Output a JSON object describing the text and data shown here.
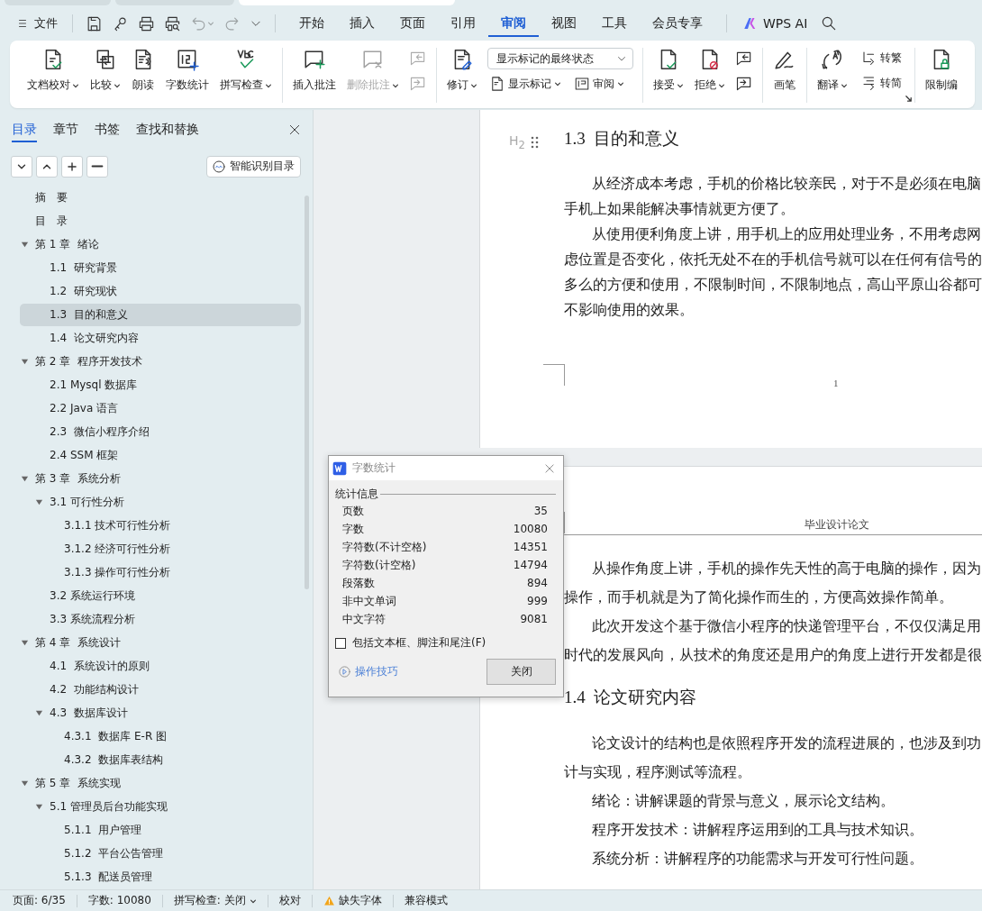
{
  "document_tabs": [
    {
      "selected": false
    },
    {
      "selected": false
    },
    {
      "selected": true
    }
  ],
  "file_menu": {
    "label": "文件"
  },
  "quick_access": [
    {
      "disabled": false
    },
    {
      "disabled": false
    },
    {
      "disabled": false
    },
    {
      "disabled": false
    },
    {
      "disabled": true
    },
    {
      "disabled": true
    },
    {
      "disabled": false
    }
  ],
  "menu_tabs": [
    {
      "label": "开始",
      "selected": false
    },
    {
      "label": "插入",
      "selected": false
    },
    {
      "label": "页面",
      "selected": false
    },
    {
      "label": "引用",
      "selected": false
    },
    {
      "label": "审阅",
      "selected": true
    },
    {
      "label": "视图",
      "selected": false
    },
    {
      "label": "工具",
      "selected": false
    },
    {
      "label": "会员专享",
      "selected": false
    }
  ],
  "ai_button": {
    "label": "WPS AI"
  },
  "ribbon": {
    "groups": [
      {
        "items": [
          {
            "kind": "large",
            "label": "文档校对",
            "caret": true,
            "disabled": false
          },
          {
            "kind": "large",
            "label": "比较",
            "caret": true,
            "disabled": false
          },
          {
            "kind": "large",
            "label": "朗读",
            "caret": false,
            "disabled": false
          },
          {
            "kind": "large",
            "label": "字数统计",
            "caret": false,
            "disabled": false
          },
          {
            "kind": "large",
            "label": "拼写检查",
            "caret": true,
            "disabled": false
          }
        ]
      },
      {
        "items": [
          {
            "kind": "large",
            "label": "插入批注",
            "caret": false,
            "disabled": false
          },
          {
            "kind": "large",
            "label": "删除批注",
            "caret": true,
            "disabled": true
          },
          {
            "kind": "icons",
            "disabled": true
          }
        ]
      },
      {
        "items": [
          {
            "kind": "large",
            "label": "修订",
            "caret": true,
            "disabled": false
          },
          {
            "kind": "review",
            "select": "显示标记的最终状态",
            "buttons": [
              {
                "label": "显示标记",
                "caret": true
              },
              {
                "label": "审阅",
                "caret": true
              }
            ]
          }
        ]
      },
      {
        "items": [
          {
            "kind": "large",
            "label": "接受",
            "caret": true,
            "disabled": false
          },
          {
            "kind": "large",
            "label": "拒绝",
            "caret": true,
            "disabled": false
          },
          {
            "kind": "icons",
            "disabled": false
          }
        ]
      },
      {
        "items": [
          {
            "kind": "large",
            "label": "画笔",
            "caret": false,
            "disabled": false
          }
        ]
      },
      {
        "items": [
          {
            "kind": "large",
            "label": "翻译",
            "caret": true,
            "disabled": false
          },
          {
            "kind": "convert",
            "buttons": [
              {
                "label": "转繁"
              },
              {
                "label": "转简"
              }
            ]
          }
        ],
        "launcher": true
      },
      {
        "items": [
          {
            "kind": "large",
            "label": "限制编",
            "caret": false,
            "disabled": false
          }
        ]
      }
    ]
  },
  "nav": {
    "tabs": [
      {
        "label": "目录",
        "selected": true
      },
      {
        "label": "章节",
        "selected": false
      },
      {
        "label": "书签",
        "selected": false
      },
      {
        "label": "查找和替换",
        "selected": false
      }
    ],
    "smart_button": {
      "label": "智能识别目录"
    },
    "toc": [
      {
        "label": "摘　要",
        "selected": false
      },
      {
        "label": "目　录",
        "selected": false
      },
      {
        "label": "第 1 章  绪论",
        "selected": false,
        "expanded": true,
        "children": [
          {
            "label": "1.1  研究背景",
            "selected": false
          },
          {
            "label": "1.2  研究现状",
            "selected": false
          },
          {
            "label": "1.3  目的和意义",
            "selected": true
          },
          {
            "label": "1.4  论文研究内容",
            "selected": false
          }
        ]
      },
      {
        "label": "第 2 章  程序开发技术",
        "selected": false,
        "expanded": true,
        "children": [
          {
            "label": "2.1 Mysql 数据库",
            "selected": false
          },
          {
            "label": "2.2 Java 语言",
            "selected": false
          },
          {
            "label": "2.3  微信小程序介绍",
            "selected": false
          },
          {
            "label": "2.4 SSM 框架",
            "selected": false
          }
        ]
      },
      {
        "label": "第 3 章  系统分析",
        "selected": false,
        "expanded": true,
        "children": [
          {
            "label": "3.1 可行性分析",
            "selected": false,
            "expanded": true,
            "children": [
              {
                "label": "3.1.1 技术可行性分析",
                "selected": false
              },
              {
                "label": "3.1.2 经济可行性分析",
                "selected": false
              },
              {
                "label": "3.1.3 操作可行性分析",
                "selected": false
              }
            ]
          },
          {
            "label": "3.2 系统运行环境",
            "selected": false
          },
          {
            "label": "3.3 系统流程分析",
            "selected": false
          }
        ]
      },
      {
        "label": "第 4 章  系统设计",
        "selected": false,
        "expanded": true,
        "children": [
          {
            "label": "4.1  系统设计的原则",
            "selected": false
          },
          {
            "label": "4.2  功能结构设计",
            "selected": false
          },
          {
            "label": "4.3  数据库设计",
            "selected": false,
            "expanded": true,
            "children": [
              {
                "label": "4.3.1  数据库 E-R 图",
                "selected": false
              },
              {
                "label": "4.3.2  数据库表结构",
                "selected": false
              }
            ]
          }
        ]
      },
      {
        "label": "第 5 章  系统实现",
        "selected": false,
        "expanded": true,
        "children": [
          {
            "label": "5.1 管理员后台功能实现",
            "selected": false,
            "expanded": true,
            "children": [
              {
                "label": "5.1.1  用户管理",
                "selected": false
              },
              {
                "label": "5.1.2  平台公告管理",
                "selected": false
              },
              {
                "label": "5.1.3  配送员管理",
                "selected": false
              }
            ]
          }
        ]
      }
    ]
  },
  "document": {
    "pages": [
      {
        "heading_marker": "H$_{2}$",
        "blocks": [
          {
            "kind": "heading",
            "text": "1.3  目的和意义"
          },
          {
            "kind": "paragraph",
            "lines": [
              "从经济成本考虑，手机的价格比较亲民，对于不是必须在电脑",
              "手机上如果能解决事情就更方便了。"
            ]
          },
          {
            "kind": "paragraph",
            "lines": [
              "从使用便利角度上讲，用手机上的应用处理业务，不用考虑网",
              "虑位置是否变化，依托无处不在的手机信号就可以在任何有信号的",
              "多么的方便和使用，不限制时间，不限制地点，高山平原山谷都可",
              "不影响使用的效果。"
            ]
          }
        ],
        "page_number": "1"
      },
      {
        "header": "毕业设计论文",
        "blocks": [
          {
            "kind": "paragraph",
            "lines": [
              "从操作角度上讲，手机的操作先天性的高于电脑的操作，因为",
              "操作，而手机就是为了简化操作而生的，方便高效操作简单。"
            ]
          },
          {
            "kind": "paragraph",
            "lines": [
              "此次开发这个基于微信小程序的快递管理平台，不仅仅满足用",
              "时代的发展风向，从技术的角度还是用户的角度上进行开发都是很"
            ]
          },
          {
            "kind": "heading",
            "text": "1.4  论文研究内容"
          },
          {
            "kind": "paragraph",
            "lines": [
              "论文设计的结构也是依照程序开发的流程进展的，也涉及到功",
              "计与实现，程序测试等流程。"
            ]
          },
          {
            "kind": "paragraph",
            "lines": [
              "绪论：讲解课题的背景与意义，展示论文结构。"
            ]
          },
          {
            "kind": "paragraph",
            "lines": [
              "程序开发技术：讲解程序运用到的工具与技术知识。"
            ]
          },
          {
            "kind": "paragraph",
            "lines": [
              "系统分析：讲解程序的功能需求与开发可行性问题。"
            ]
          }
        ]
      }
    ]
  },
  "word_count_dialog": {
    "title": "字数统计",
    "group": "统计信息",
    "stats": [
      {
        "label": "页数",
        "value": "35"
      },
      {
        "label": "字数",
        "value": "10080"
      },
      {
        "label": "字符数(不计空格)",
        "value": "14351"
      },
      {
        "label": "字符数(计空格)",
        "value": "14794"
      },
      {
        "label": "段落数",
        "value": "894"
      },
      {
        "label": "非中文单词",
        "value": "999"
      },
      {
        "label": "中文字符",
        "value": "9081"
      }
    ],
    "include_option": {
      "label": "包括文本框、脚注和尾注(F)",
      "checked": false
    },
    "tips_link": "操作技巧",
    "close_button": "关闭"
  },
  "status_bar": {
    "items": [
      {
        "kind": "text",
        "label": "页面: 6/35"
      },
      {
        "kind": "text",
        "label": "字数: 10080"
      },
      {
        "kind": "dropdown",
        "label": "拼写检查: 关闭"
      },
      {
        "kind": "text",
        "label": "校对"
      },
      {
        "kind": "warning",
        "label": "缺失字体"
      },
      {
        "kind": "text",
        "label": "兼容模式"
      }
    ]
  }
}
